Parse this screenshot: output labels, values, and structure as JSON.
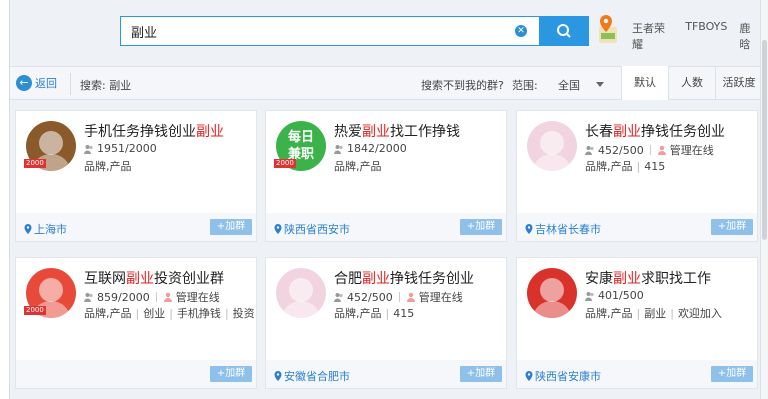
{
  "search": {
    "value": "副业"
  },
  "topnav": [
    "王者荣耀",
    "TFBOYS",
    "鹿晗"
  ],
  "toolbar": {
    "back": "返回",
    "crumb": "搜索: 副业",
    "not_found": "搜索不到我的群?",
    "scope_label": "范围:",
    "scope_value": "全国",
    "sort_tabs": [
      "默认",
      "人数",
      "活跃度"
    ]
  },
  "cards": [
    {
      "pre": "手机任务挣钱创业",
      "hl": "副业",
      "post": "",
      "members": "1951/2000",
      "admin": "",
      "tags": [
        "品牌,产品"
      ],
      "location": "上海市",
      "join": "+加群",
      "level": "2000",
      "avatar_color": "#8a5a2a"
    },
    {
      "pre": "热爱",
      "hl": "副业",
      "post": "找工作挣钱",
      "members": "1842/2000",
      "admin": "",
      "tags": [
        "品牌,产品"
      ],
      "location": "陕西省西安市",
      "join": "+加群",
      "level": "2000",
      "avatar_color": "#3bb34a",
      "avatar_text": [
        "每日",
        "兼职"
      ]
    },
    {
      "pre": "长春",
      "hl": "副业",
      "post": "挣钱任务创业",
      "members": "452/500",
      "admin": "管理在线",
      "tags": [
        "品牌,产品",
        "415"
      ],
      "location": "吉林省长春市",
      "join": "+加群",
      "level": "",
      "avatar_color": "#f2d4e0"
    },
    {
      "pre": "互联网",
      "hl": "副业",
      "post": "投资创业群",
      "members": "859/2000",
      "admin": "管理在线",
      "tags": [
        "品牌,产品",
        "创业",
        "手机挣钱",
        "投资 ..."
      ],
      "location": "",
      "join": "+加群",
      "level": "2000",
      "avatar_color": "#e84a3a"
    },
    {
      "pre": "合肥",
      "hl": "副业",
      "post": "挣钱任务创业",
      "members": "452/500",
      "admin": "管理在线",
      "tags": [
        "品牌,产品",
        "415"
      ],
      "location": "安徽省合肥市",
      "join": "+加群",
      "level": "",
      "avatar_color": "#f2d4e0"
    },
    {
      "pre": "安康",
      "hl": "副业",
      "post": "求职找工作",
      "members": "401/500",
      "admin": "",
      "tags": [
        "品牌,产品",
        "副业",
        "欢迎加入"
      ],
      "location": "陕西省安康市",
      "join": "+加群",
      "level": "",
      "avatar_color": "#d8322a"
    }
  ],
  "colors": {
    "accent": "#2b97e0",
    "highlight": "#e02020",
    "join_button": "#8ec0ea"
  }
}
